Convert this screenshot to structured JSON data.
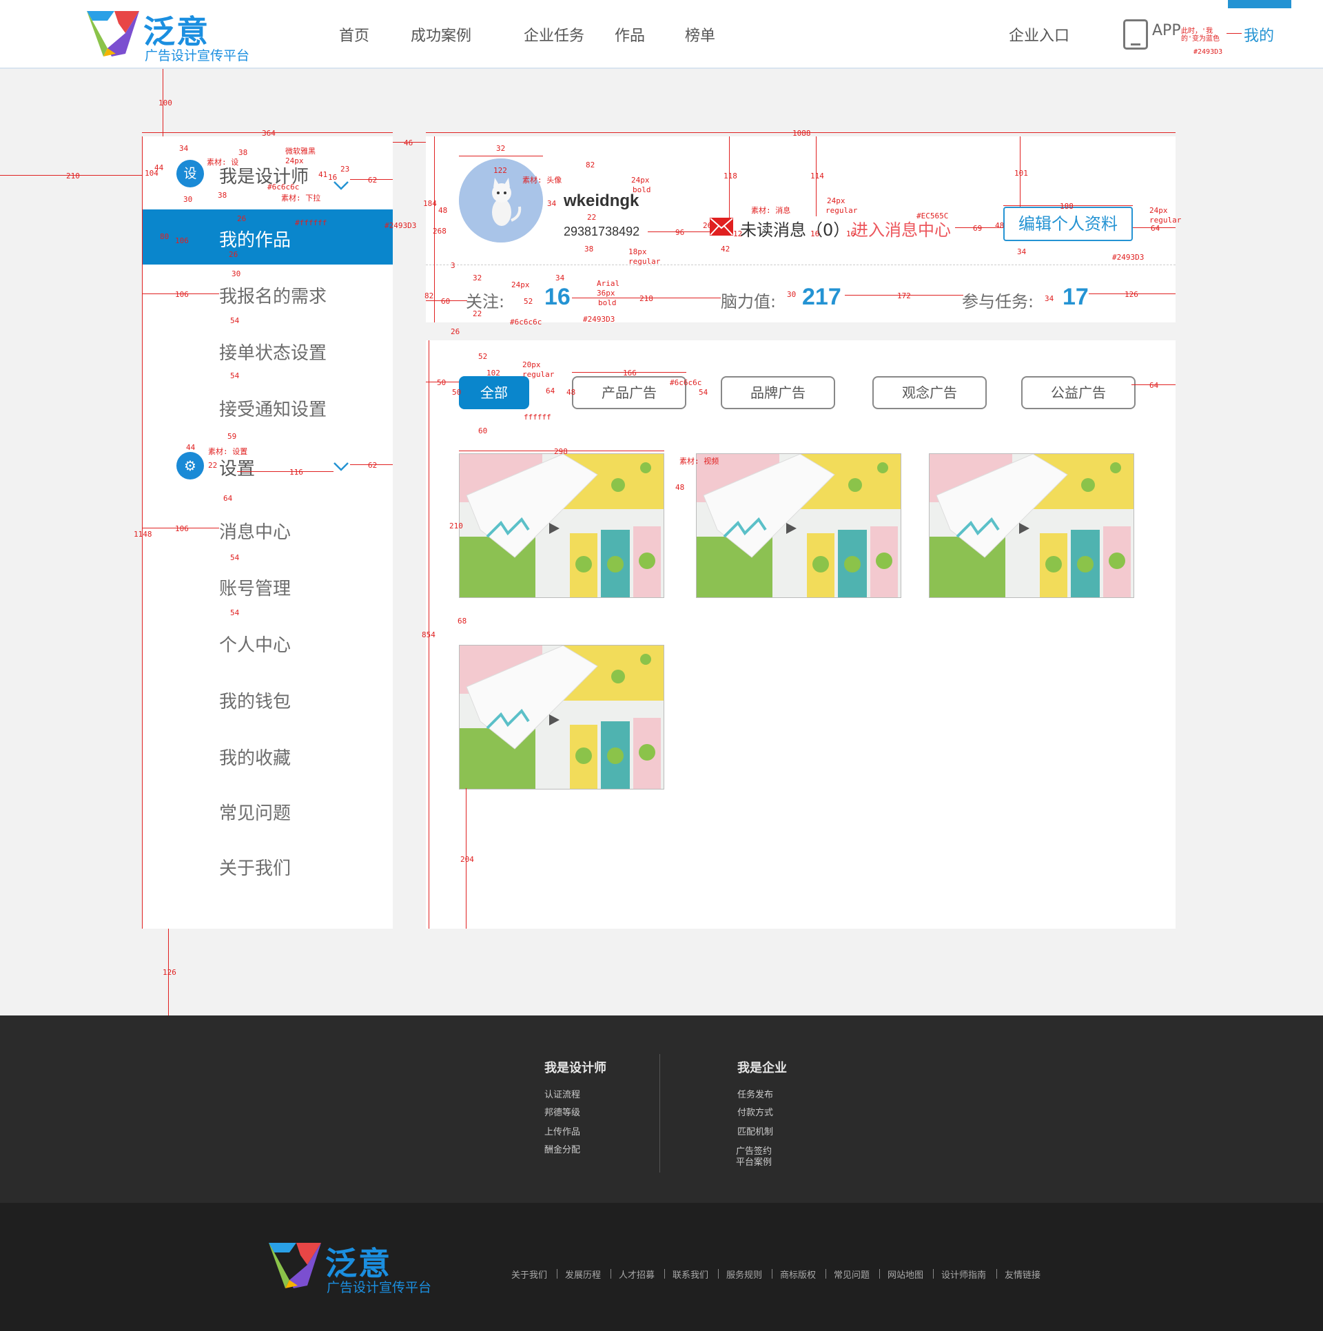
{
  "header": {
    "logo_name": "泛意",
    "logo_slogan": "广告设计宣传平台",
    "nav": [
      "首页",
      "成功案例",
      "企业任务",
      "作品",
      "榜单"
    ],
    "enterprise_entry": "企业入口",
    "app_label": "APP",
    "my_label": "我的",
    "accent_color": "#2493d3"
  },
  "sidebar": {
    "designer_head": "我是设计师",
    "designer_icon_text": "设",
    "items": [
      "我的作品",
      "我报名的需求",
      "接单状态设置",
      "接受通知设置"
    ],
    "settings_head": "设置",
    "settings_items": [
      "消息中心",
      "账号管理",
      "个人中心",
      "我的钱包",
      "我的收藏",
      "常见问题",
      "关于我们"
    ]
  },
  "profile": {
    "username": "wkeidngk",
    "user_id": "29381738492",
    "unread_label": "未读消息",
    "unread_count": "（0）",
    "go_message": "进入消息中心",
    "edit_button": "编辑个人资料",
    "follow_label": "关注:",
    "follow_value": "16",
    "brain_label": "脑力值:",
    "brain_value": "217",
    "task_label": "参与任务:",
    "task_value": "17"
  },
  "works": {
    "tabs": [
      "全部",
      "产品广告",
      "品牌广告",
      "观念广告",
      "公益广告"
    ],
    "active_tab": "全部",
    "thumb_count": 4
  },
  "annotations": {
    "top": [
      "100",
      "364",
      "46",
      "1088",
      "210",
      "34",
      "38",
      "微软雅黑",
      "24px",
      "素材: 设",
      "#6c6c6c",
      "素材: 下拉",
      "23",
      "41",
      "16",
      "62",
      "44",
      "104",
      "30",
      "38",
      "26",
      "#ffffff",
      "#2493D3",
      "80",
      "106",
      "26",
      "30",
      "106",
      "54",
      "54",
      "59",
      "44",
      "素材: 设置",
      "22",
      "116",
      "62",
      "1148",
      "106",
      "64",
      "54",
      "54",
      "126"
    ],
    "profile": [
      "32",
      "素材: 头像",
      "122",
      "34",
      "24px",
      "bold",
      "82",
      "22",
      "18px",
      "regular",
      "38",
      "96",
      "118",
      "素材: 消息",
      "26",
      "12",
      "16",
      "42",
      "114",
      "24px",
      "regular",
      "16",
      "#EC565C",
      "69",
      "101",
      "188",
      "48",
      "24px",
      "regular",
      "64",
      "34",
      "#2493D3",
      "184",
      "48",
      "268",
      "3",
      "82",
      "60",
      "24px",
      "32",
      "22",
      "52",
      "#6c6c6c",
      "34",
      "Arial",
      "36px",
      "bold",
      "#2493D3",
      "218",
      "30",
      "172",
      "34",
      "126",
      "此时，'我的'变为蓝色",
      "#2493D3"
    ],
    "works": [
      "26",
      "52",
      "50",
      "102",
      "20px",
      "regular",
      "166",
      "#6c6c6c",
      "50",
      "64",
      "48",
      "54",
      "ffffff",
      "60",
      "64",
      "298",
      "素材: 视频",
      "48",
      "210",
      "68",
      "854",
      "204"
    ]
  },
  "footer": {
    "designer_title": "我是设计师",
    "designer_items": [
      "认证流程",
      "邦德等级",
      "上传作品",
      "酬金分配"
    ],
    "enterprise_title": "我是企业",
    "enterprise_items": [
      "任务发布",
      "付款方式",
      "匹配机制",
      "广告签约",
      "平台案例"
    ],
    "links": [
      "关于我们",
      "发展历程",
      "人才招募",
      "联系我们",
      "服务规则",
      "商标版权",
      "常见问题",
      "网站地图",
      "设计师指南",
      "友情链接"
    ],
    "logo_name": "泛意",
    "logo_slogan": "广告设计宣传平台"
  }
}
